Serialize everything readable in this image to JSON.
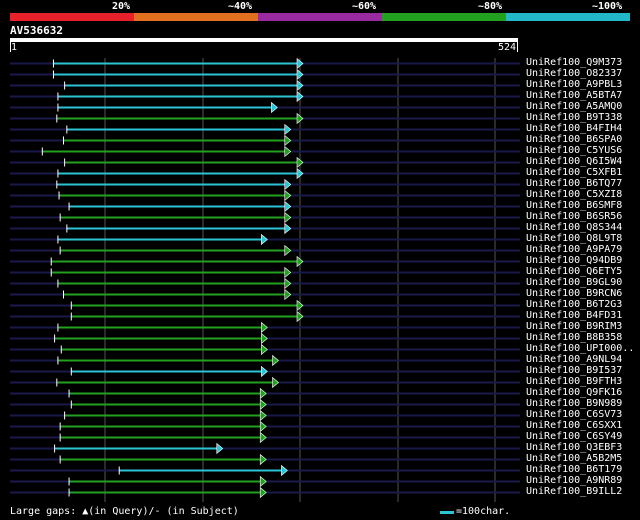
{
  "scale": {
    "labels": [
      "20%",
      "~40%",
      "~60%",
      "~80%",
      "~100%"
    ],
    "colors": [
      "#e8202a",
      "#e07020",
      "#9a2aa0",
      "#22a020",
      "#22b8c8"
    ]
  },
  "query": {
    "name": "AV536632",
    "start": "1",
    "end": "524"
  },
  "colors": {
    "cyan": "#2cc4d4",
    "green": "#22a020",
    "grid": "#1a1a4a",
    "vline": "#555555"
  },
  "hits": [
    {
      "name": "UniRef100_Q9M373",
      "start": 78,
      "end": 524,
      "color": "cyan",
      "gapline": true
    },
    {
      "name": "UniRef100_O82337",
      "start": 78,
      "end": 524,
      "color": "cyan",
      "gapline": true
    },
    {
      "name": "UniRef100_A9PBL3",
      "start": 98,
      "end": 524,
      "color": "cyan",
      "gapline": true
    },
    {
      "name": "UniRef100_A5BTA7",
      "start": 86,
      "end": 524,
      "color": "cyan",
      "gapline": true
    },
    {
      "name": "UniRef100_A5AMQ0",
      "start": 86,
      "end": 478,
      "color": "cyan",
      "gapline": false
    },
    {
      "name": "UniRef100_B9T338",
      "start": 84,
      "end": 524,
      "color": "green",
      "gapline": true
    },
    {
      "name": "UniRef100_B4FIH4",
      "start": 102,
      "end": 502,
      "color": "cyan",
      "gapline": false
    },
    {
      "name": "UniRef100_B6SPA0",
      "start": 96,
      "end": 502,
      "color": "green",
      "gapline": false
    },
    {
      "name": "UniRef100_C5YUS6",
      "start": 58,
      "end": 502,
      "color": "green",
      "gapline": true
    },
    {
      "name": "UniRef100_Q6I5W4",
      "start": 98,
      "end": 524,
      "color": "green",
      "gapline": false
    },
    {
      "name": "UniRef100_C5XFB1",
      "start": 86,
      "end": 524,
      "color": "cyan",
      "gapline": false
    },
    {
      "name": "UniRef100_B6TQ77",
      "start": 84,
      "end": 502,
      "color": "cyan",
      "gapline": false
    },
    {
      "name": "UniRef100_C5XZI8",
      "start": 88,
      "end": 502,
      "color": "green",
      "gapline": false
    },
    {
      "name": "UniRef100_B6SMF8",
      "start": 106,
      "end": 502,
      "color": "cyan",
      "gapline": true
    },
    {
      "name": "UniRef100_B6SR56",
      "start": 90,
      "end": 502,
      "color": "green",
      "gapline": false
    },
    {
      "name": "UniRef100_Q8S344",
      "start": 102,
      "end": 502,
      "color": "cyan",
      "gapline": false
    },
    {
      "name": "UniRef100_Q8L9T8",
      "start": 86,
      "end": 460,
      "color": "cyan",
      "gapline": false
    },
    {
      "name": "UniRef100_A9PA79",
      "start": 90,
      "end": 502,
      "color": "green",
      "gapline": false
    },
    {
      "name": "UniRef100_Q94DB9",
      "start": 74,
      "end": 524,
      "color": "green",
      "gapline": true
    },
    {
      "name": "UniRef100_Q6ETY5",
      "start": 74,
      "end": 502,
      "color": "green",
      "gapline": true
    },
    {
      "name": "UniRef100_B9GL90",
      "start": 86,
      "end": 502,
      "color": "green",
      "gapline": true
    },
    {
      "name": "UniRef100_B9RCN6",
      "start": 96,
      "end": 502,
      "color": "green",
      "gapline": true
    },
    {
      "name": "UniRef100_B6T2G3",
      "start": 110,
      "end": 524,
      "color": "green",
      "gapline": false
    },
    {
      "name": "UniRef100_B4FD31",
      "start": 110,
      "end": 524,
      "color": "green",
      "gapline": false
    },
    {
      "name": "UniRef100_B9RIM3",
      "start": 86,
      "end": 460,
      "color": "green",
      "gapline": false
    },
    {
      "name": "UniRef100_B8B358",
      "start": 80,
      "end": 460,
      "color": "green",
      "gapline": false
    },
    {
      "name": "UniRef100_UPI000..",
      "start": 92,
      "end": 460,
      "color": "green",
      "gapline": false
    },
    {
      "name": "UniRef100_A9NL94",
      "start": 86,
      "end": 480,
      "color": "green",
      "gapline": false
    },
    {
      "name": "UniRef100_B9I537",
      "start": 110,
      "end": 460,
      "color": "cyan",
      "gapline": false
    },
    {
      "name": "UniRef100_B9FTH3",
      "start": 84,
      "end": 480,
      "color": "green",
      "gapline": false
    },
    {
      "name": "UniRef100_Q9FK16",
      "start": 106,
      "end": 458,
      "color": "green",
      "gapline": false
    },
    {
      "name": "UniRef100_B9N989",
      "start": 110,
      "end": 458,
      "color": "green",
      "gapline": false
    },
    {
      "name": "UniRef100_C6SV73",
      "start": 98,
      "end": 458,
      "color": "green",
      "gapline": false
    },
    {
      "name": "UniRef100_C6SXX1",
      "start": 90,
      "end": 458,
      "color": "green",
      "gapline": false
    },
    {
      "name": "UniRef100_C6SY49",
      "start": 90,
      "end": 458,
      "color": "green",
      "gapline": false
    },
    {
      "name": "UniRef100_Q3EBF3",
      "start": 80,
      "end": 380,
      "color": "cyan",
      "gapline": false
    },
    {
      "name": "UniRef100_A5B2M5",
      "start": 90,
      "end": 458,
      "color": "green",
      "gapline": false
    },
    {
      "name": "UniRef100_B6T179",
      "start": 196,
      "end": 496,
      "color": "cyan",
      "gapline": false
    },
    {
      "name": "UniRef100_A9NR89",
      "start": 106,
      "end": 458,
      "color": "green",
      "gapline": false
    },
    {
      "name": "UniRef100_B9ILL2",
      "start": 106,
      "end": 458,
      "color": "green",
      "gapline": false
    }
  ],
  "legend": {
    "left": "Large gaps: ▲(in Query)/- (in Subject)",
    "right": "=100char."
  }
}
